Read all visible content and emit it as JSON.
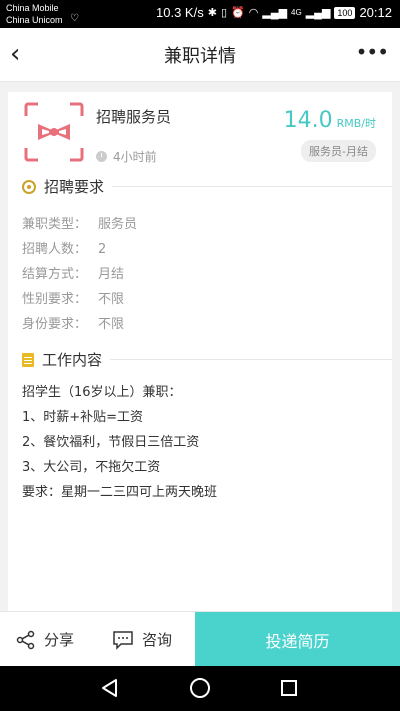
{
  "status_bar": {
    "carrier_1": "China Mobile",
    "carrier_2": "China Unicom",
    "speed": "10.3 K/s",
    "network": "4G",
    "battery": "100",
    "time": "20:12"
  },
  "nav": {
    "title": "兼职详情"
  },
  "job": {
    "title": "招聘服务员",
    "posted": "4小时前",
    "salary_value": "14.0",
    "salary_unit": "RMB/时",
    "tag": "服务员-月结"
  },
  "requirements": {
    "heading": "招聘要求",
    "rows": [
      {
        "key": "兼职类型：",
        "value": "服务员"
      },
      {
        "key": "招聘人数：",
        "value": "2"
      },
      {
        "key": "结算方式：",
        "value": "月结"
      },
      {
        "key": "性别要求：",
        "value": "不限"
      },
      {
        "key": "身份要求：",
        "value": "不限"
      }
    ]
  },
  "work": {
    "heading": "工作内容",
    "lines": [
      "招学生（16岁以上）兼职：",
      "1、时薪+补贴=工资",
      "2、餐饮福利，节假日三倍工资",
      "3、大公司，不拖欠工资",
      "要求：星期一二三四可上两天晚班"
    ]
  },
  "bottom": {
    "share_label": "分享",
    "consult_label": "咨询",
    "apply_label": "投递简历"
  },
  "colors": {
    "accent": "#4ad2cc",
    "salary": "#46c8c4",
    "logo": "#e8707a"
  }
}
